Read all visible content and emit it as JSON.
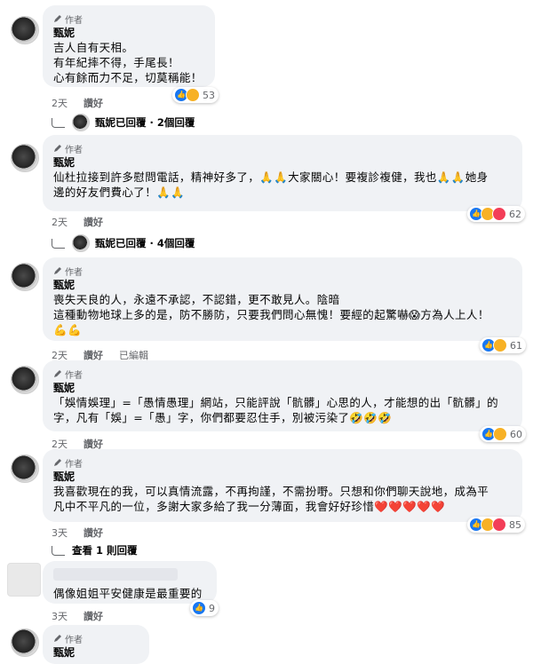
{
  "comments": [
    {
      "badge": "作者",
      "name": "甄妮",
      "text": "吉人自有天相。\n有年紀摔不得，手尾長！\n心有餘而力不足，切莫稱能！",
      "time": "2天",
      "action": "讚好",
      "reactions": "53",
      "replies": "甄妮已回覆 · 2個回覆"
    },
    {
      "badge": "作者",
      "name": "甄妮",
      "text": "仙杜拉接到許多慰問電話，精神好多了，🙏🙏大家關心！要複診複健，我也🙏🙏她身\n邊的好友們費心了！🙏🙏",
      "time": "2天",
      "action": "讚好",
      "reactions": "62",
      "replies": "甄妮已回覆 · 4個回覆"
    },
    {
      "badge": "作者",
      "name": "甄妮",
      "text": "喪失天良的人，永遠不承認，不認錯，更不敢見人。陰暗\n這種動物地球上多的是，防不勝防，只要我們問心無愧！要經的起驚嚇😱方為人上人！\n💪💪",
      "time": "2天",
      "action": "讚好",
      "extra": "已編輯",
      "reactions": "61"
    },
    {
      "badge": "作者",
      "name": "甄妮",
      "text": "「娛情娛理」=「愚情愚理」網站，只能評說「骯髒」心思的人，才能想的出「骯髒」的\n字，凡有「娛」=「愚」字，你們都要忍住手，別被污染了🤣🤣🤣",
      "time": "2天",
      "action": "讚好",
      "reactions": "60"
    },
    {
      "badge": "作者",
      "name": "甄妮",
      "text": "我喜歡現在的我，可以真情流露，不再拘謹，不需扮嘢。只想和你們聊天說地，成為平\n凡中不平凡的一位，多謝大家多給了我一分薄面，我會好好珍惜❤️❤️❤️❤️❤️",
      "time": "3天",
      "action": "讚好",
      "reactions": "85",
      "replies": "查看 1 則回覆"
    },
    {
      "text": "偶像姐姐平安健康是最重要的",
      "time": "3天",
      "action": "讚好",
      "reactions": "9"
    },
    {
      "badge": "作者",
      "name": "甄妮"
    }
  ]
}
